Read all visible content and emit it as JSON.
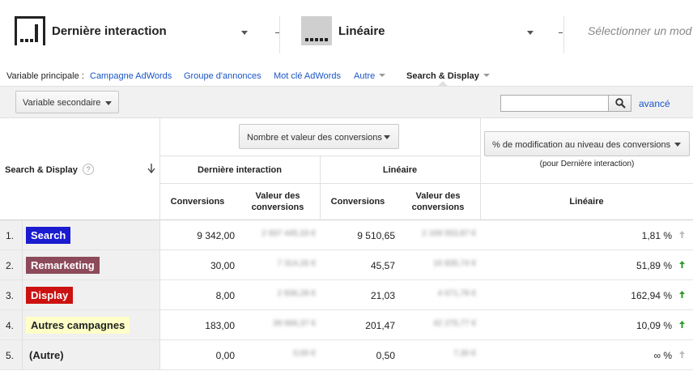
{
  "models": {
    "first": {
      "label": "Dernière interaction"
    },
    "second": {
      "label": "Linéaire"
    },
    "third": {
      "placeholder": "Sélectionner un mod"
    }
  },
  "primary_dimension": {
    "label": "Variable principale :",
    "links": [
      "Campagne AdWords",
      "Groupe d'annonces",
      "Mot clé AdWords",
      "Autre"
    ],
    "selected": "Search & Display"
  },
  "toolbar": {
    "secondary_label": "Variable secondaire",
    "advanced_label": "avancé"
  },
  "table": {
    "dimension_header": "Search & Display",
    "help_glyph": "?",
    "metric_select": "Nombre et valeur des conversions",
    "pct_select": "% de modification au niveau des conversions",
    "pct_sub": "(pour Dernière interaction)",
    "group1": "Dernière interaction",
    "group2": "Linéaire",
    "pct_col": "Linéaire",
    "col_conv": "Conversions",
    "col_value": "Valeur des conversions",
    "rows": [
      {
        "idx": "1.",
        "name": "Search",
        "bg": "#1b1bd0",
        "fg": "#ffffff",
        "conv1": "9 342,00",
        "val1": "2 937 445,33 €",
        "conv2": "9 510,65",
        "val2": "2 169 553,87 €",
        "pct": "1,81 %",
        "trend": "neutral"
      },
      {
        "idx": "2.",
        "name": "Remarketing",
        "bg": "#8c4a5a",
        "fg": "#ffffff",
        "conv1": "30,00",
        "val1": "7 314,26 €",
        "conv2": "45,57",
        "val2": "16 835,74 €",
        "pct": "51,89 %",
        "trend": "up"
      },
      {
        "idx": "3.",
        "name": "Display",
        "bg": "#cc1111",
        "fg": "#ffffff",
        "conv1": "8,00",
        "val1": "2 836,28 €",
        "conv2": "21,03",
        "val2": "4 671,78 €",
        "pct": "162,94 %",
        "trend": "up"
      },
      {
        "idx": "4.",
        "name": "Autres campagnes",
        "bg": "#ffffc8",
        "fg": "#222222",
        "conv1": "183,00",
        "val1": "39 666,37 €",
        "conv2": "201,47",
        "val2": "42 275,77 €",
        "pct": "10,09 %",
        "trend": "up"
      },
      {
        "idx": "5.",
        "name": "(Autre)",
        "bg": "",
        "fg": "#222222",
        "conv1": "0,00",
        "val1": "0,00 €",
        "conv2": "0,50",
        "val2": "7,30 €",
        "pct": "∞ %",
        "trend": "neutral"
      }
    ]
  },
  "colors": {
    "link": "#1a55c8",
    "trend_up": "#2a9d2a",
    "trend_neutral": "#bbbbbb"
  }
}
